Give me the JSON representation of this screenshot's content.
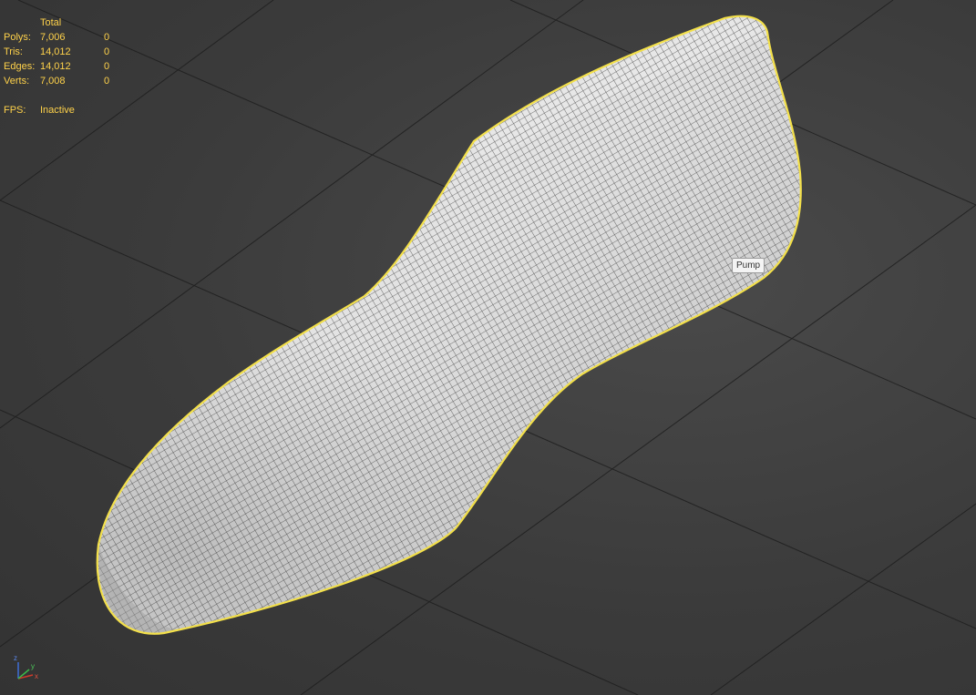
{
  "stats": {
    "header": "Total",
    "rows": [
      {
        "label": "Polys:",
        "total": "7,006",
        "selected": "0"
      },
      {
        "label": "Tris:",
        "total": "14,012",
        "selected": "0"
      },
      {
        "label": "Edges:",
        "total": "14,012",
        "selected": "0"
      },
      {
        "label": "Verts:",
        "total": "7,008",
        "selected": "0"
      }
    ],
    "fps_label": "FPS:",
    "fps_value": "Inactive"
  },
  "tooltip": {
    "text": "Pump"
  },
  "gizmo_axes": {
    "x": "x",
    "y": "y",
    "z": "z"
  },
  "colors": {
    "viewport_bg": "#3d3d3d",
    "stats_text": "#ffd24a",
    "selection_outline": "#f3e04a",
    "mesh_fill": "#d9d9d9",
    "wire": "#1a1a1a",
    "grid": "#1c1c1c",
    "axis_x": "#d03a2a",
    "axis_y": "#3bb84a",
    "axis_z": "#3f6fd8"
  }
}
